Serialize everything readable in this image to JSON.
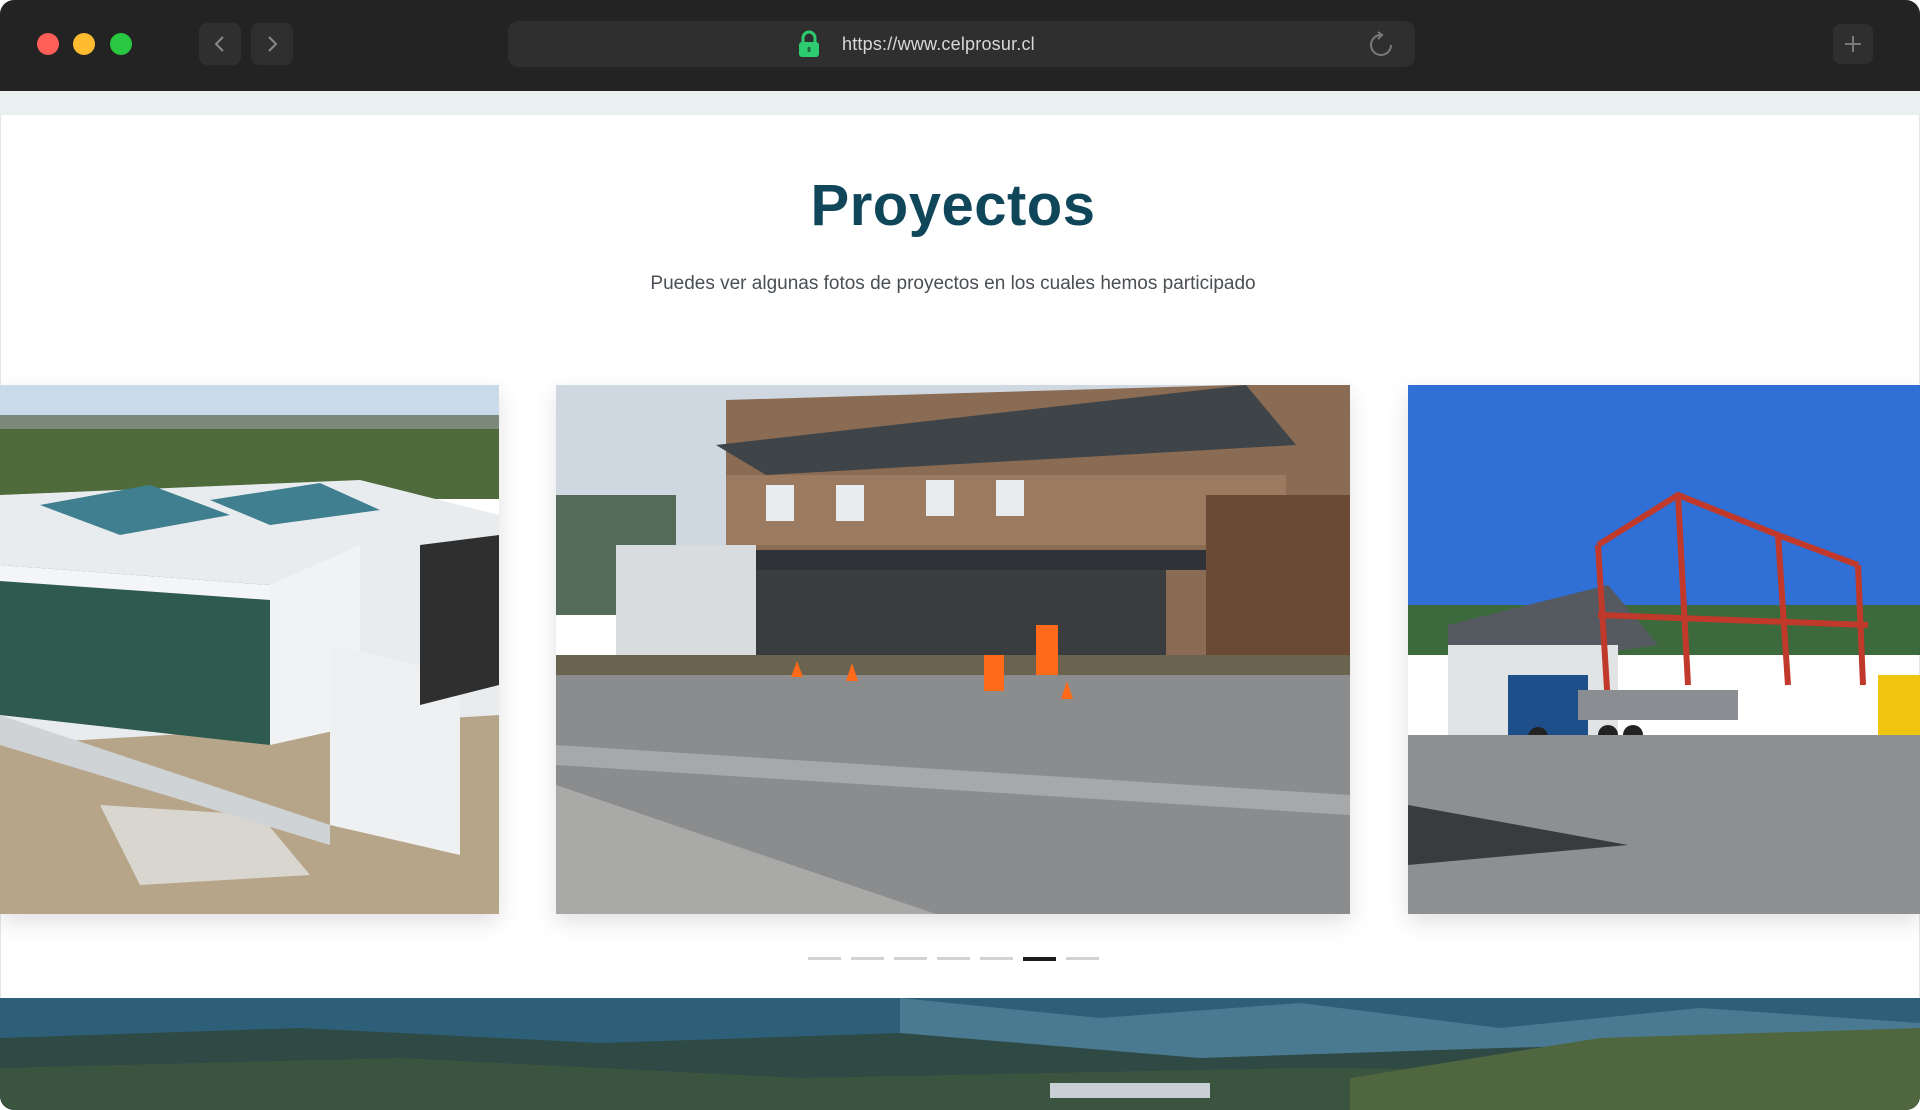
{
  "browser": {
    "url": "https://www.celprosur.cl",
    "icons": {
      "back": "chevron-left-icon",
      "forward": "chevron-right-icon",
      "secure": "lock-icon",
      "reload": "reload-icon",
      "new_tab": "plus-icon"
    }
  },
  "page": {
    "title": "Proyectos",
    "subtitle": "Puedes ver algunas fotos de proyectos en los cuales hemos participado",
    "colors": {
      "title": "#10465a",
      "lock": "#2ecc71",
      "active_dot": "#1b1b1b"
    }
  },
  "carousel": {
    "slides": [
      {
        "id": "slide-prev",
        "depicts": "modern building construction"
      },
      {
        "id": "slide-current",
        "depicts": "street works in front of a shingle building"
      },
      {
        "id": "slide-next",
        "depicts": "steel frame construction with crane truck"
      }
    ],
    "dots_total": 7,
    "active_dot": 6
  }
}
